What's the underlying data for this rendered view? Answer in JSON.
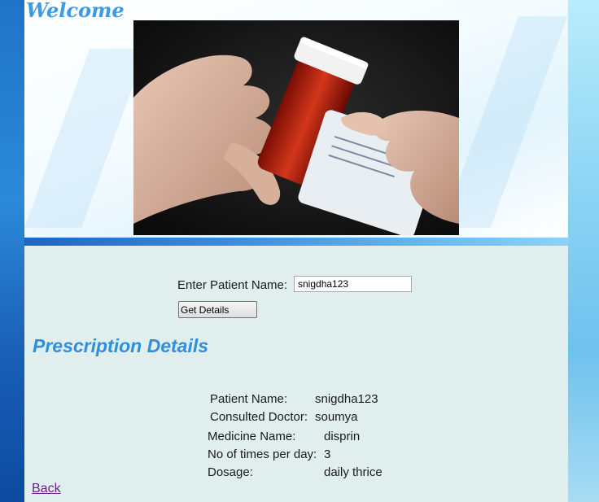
{
  "header": {
    "welcome": "Welcome"
  },
  "search": {
    "label": "Enter Patient Name:",
    "value": "snigdha123",
    "button_label": "Get Details"
  },
  "prescription": {
    "heading": "Prescription Details",
    "patient_name_label": "Patient Name:",
    "patient_name_value": "snigdha123",
    "doctor_label": "Consulted Doctor:",
    "doctor_value": "soumya",
    "medicine_label": "Medicine Name:",
    "medicine_value": "disprin",
    "times_label": "No of times per day:",
    "times_value": "3",
    "dosage_label": "Dosage:",
    "dosage_value": "daily thrice"
  },
  "nav": {
    "back_label": "Back"
  },
  "colors": {
    "heading": "#2f8fdc",
    "link_visited": "#6b1f8a",
    "content_bg": "#e0eeee"
  }
}
